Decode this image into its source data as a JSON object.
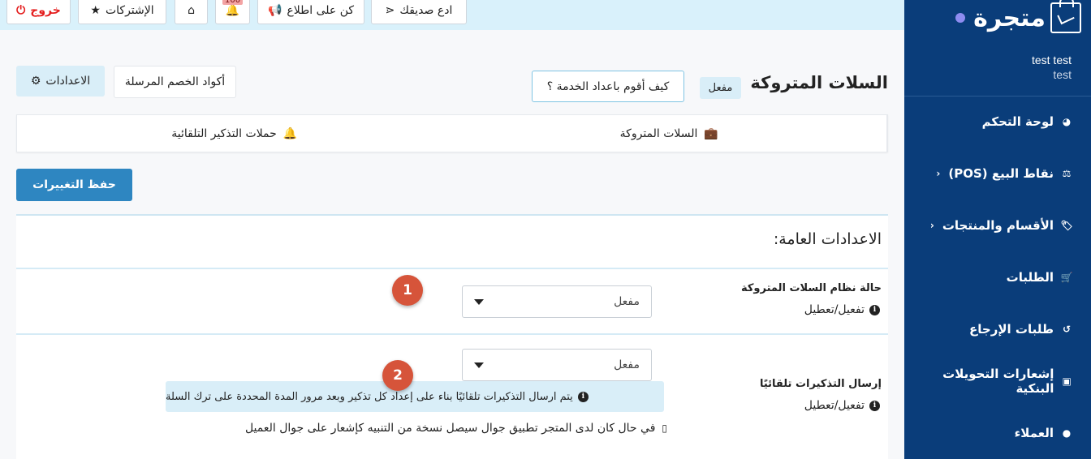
{
  "sidebar": {
    "brand": "متجرة",
    "user_name": "test test",
    "user_sub": "test",
    "items": [
      {
        "label": "لوحة التحكم",
        "icon": "dashboard-icon"
      },
      {
        "label": "نقاط البيع (POS)",
        "icon": "balance-scale-icon",
        "chevron": "‹"
      },
      {
        "label": "الأقسام والمنتجات",
        "icon": "tag-icon",
        "chevron": "‹"
      },
      {
        "label": "الطلبات",
        "icon": "cart-icon"
      },
      {
        "label": "طلبات الإرجاع",
        "icon": "undo-icon"
      },
      {
        "label": "إشعارات التحويلات البنكية",
        "icon": "money-icon"
      },
      {
        "label": "العملاء",
        "icon": "user-icon"
      }
    ]
  },
  "topbar": {
    "invite": "ادع صديقك",
    "stay_updated": "كن على اطلاع",
    "notif_count": "100",
    "subscriptions": "الإشتركات",
    "logout": "خروج"
  },
  "header": {
    "title": "السلات المتروكة",
    "status": "مفعل",
    "help": "كيف أقوم باعداد الخدمة ؟",
    "discount_codes": "أكواد الخصم المرسلة",
    "settings": "الاعدادات"
  },
  "tabs": [
    {
      "label": "السلات المتروكة",
      "icon": "briefcase-icon"
    },
    {
      "label": "حملات التذكير التلقائية",
      "icon": "bell-icon"
    }
  ],
  "save_label": "حفظ التغييرات",
  "general": {
    "title": "الاعدادات العامة:",
    "rows": [
      {
        "label": "حالة نظام السلات المتروكة",
        "sub": "تفعيل/تعطيل",
        "value": "مفعل"
      },
      {
        "label": "إرسال التذكيرات تلقائيًا",
        "sub": "تفعيل/تعطيل",
        "value": "مفعل"
      }
    ],
    "note": "يتم ارسال التذكيرات تلقائيًا بناء على إعداد كل تذكير وبعد مرور المدة المحددة على ترك السلة",
    "note2": "في حال كان لدى المتجر تطبيق جوال سيصل نسخة من التنبيه كإشعار على جوال العميل"
  },
  "markers": [
    "1",
    "2"
  ],
  "colors": {
    "sidebar": "#0a3d7a",
    "topbar": "#d9f1fb",
    "primary": "#2e86c1",
    "marker": "#d6543a",
    "logout": "#e41d1d"
  }
}
